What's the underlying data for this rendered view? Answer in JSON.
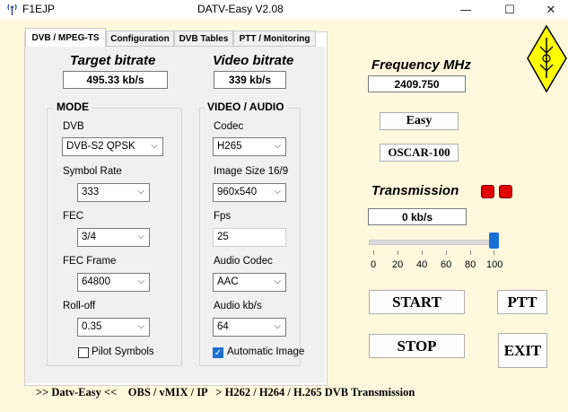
{
  "window": {
    "app_label": "F1EJP",
    "title": "DATV-Easy    V2.08",
    "minimize": "—",
    "maximize": "☐",
    "close": "✕"
  },
  "tabs": [
    {
      "label": "DVB / MPEG-TS",
      "active": true
    },
    {
      "label": "Configuration"
    },
    {
      "label": "DVB Tables"
    },
    {
      "label": "PTT / Monitoring"
    }
  ],
  "bitrates": {
    "target_label": "Target bitrate",
    "target_value": "495.33 kb/s",
    "video_label": "Video bitrate",
    "video_value": "339 kb/s"
  },
  "mode": {
    "title": "MODE",
    "dvb_label": "DVB",
    "dvb_value": "DVB-S2  QPSK",
    "symbol_rate_label": "Symbol Rate",
    "symbol_rate_value": "333",
    "fec_label": "FEC",
    "fec_value": "3/4",
    "fec_frame_label": "FEC Frame",
    "fec_frame_value": "64800",
    "rolloff_label": "Roll-off",
    "rolloff_value": "0.35",
    "pilot_label": "Pilot Symbols",
    "pilot_checked": false
  },
  "video_audio": {
    "title": "VIDEO / AUDIO",
    "codec_label": "Codec",
    "codec_value": "H265",
    "image_size_label": "Image Size 16/9",
    "image_size_value": "960x540",
    "fps_label": "Fps",
    "fps_value": "25",
    "audio_codec_label": "Audio Codec",
    "audio_codec_value": "AAC",
    "audio_kbs_label": "Audio kb/s",
    "audio_kbs_value": "64",
    "auto_image_label": "Automatic Image",
    "auto_image_checked": true
  },
  "right": {
    "frequency_label": "Frequency MHz",
    "frequency_value": "2409.750",
    "easy_button": "Easy",
    "oscar_button": "OSCAR-100",
    "transmission_label": "Transmission",
    "transmission_value": "0 kb/s",
    "slider_value_percent": 100,
    "slider_ticks": [
      "0",
      "20",
      "40",
      "60",
      "80",
      "100"
    ],
    "start_button": "START",
    "ptt_button": "PTT",
    "stop_button": "STOP",
    "exit_button": "EXIT"
  },
  "footer": ">> Datv-Easy <<    OBS / vMIX / IP   > H262 / H264 / H.265 DVB Transmission",
  "colors": {
    "background": "#fff8dc",
    "led": "#e00000",
    "slider_accent": "#1a6fd6",
    "logo_yellow": "#ffff00"
  }
}
